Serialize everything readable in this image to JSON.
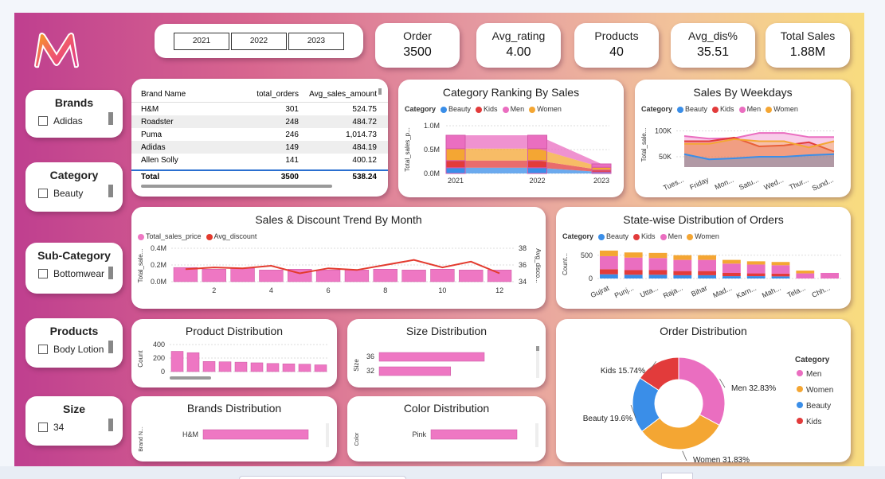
{
  "years": [
    "2021",
    "2022",
    "2023"
  ],
  "kpis": [
    {
      "label": "Order",
      "value": "3500"
    },
    {
      "label": "Avg_rating",
      "value": "4.00"
    },
    {
      "label": "Products",
      "value": "40"
    },
    {
      "label": "Avg_dis%",
      "value": "35.51"
    },
    {
      "label": "Total Sales",
      "value": "1.88M"
    }
  ],
  "slicers": [
    {
      "title": "Brands",
      "item": "Adidas"
    },
    {
      "title": "Category",
      "item": "Beauty"
    },
    {
      "title": "Sub-Category",
      "item": "Bottomwear"
    },
    {
      "title": "Products",
      "item": "Body Lotion"
    },
    {
      "title": "Size",
      "item": "34"
    }
  ],
  "brand_table": {
    "headers": [
      "Brand Name",
      "total_orders",
      "Avg_sales_amount"
    ],
    "rows": [
      [
        "H&M",
        "301",
        "524.75"
      ],
      [
        "Roadster",
        "248",
        "484.72"
      ],
      [
        "Puma",
        "246",
        "1,014.73"
      ],
      [
        "Adidas",
        "149",
        "484.19"
      ],
      [
        "Allen Solly",
        "141",
        "400.12"
      ]
    ],
    "total": [
      "Total",
      "3500",
      "538.24"
    ]
  },
  "colors": {
    "beauty": "#3a8ee8",
    "kids": "#e23b3b",
    "men": "#ea6ec0",
    "women": "#f4a633",
    "bar_pink": "#ee77c3",
    "line_red": "#e33b2e"
  },
  "legend": {
    "label": "Category",
    "items": [
      "Beauty",
      "Kids",
      "Men",
      "Women"
    ]
  },
  "category_ranking": {
    "title": "Category Ranking By Sales",
    "y_axis_label": "Total_sales_p...",
    "y_ticks": [
      "1.0M",
      "0.5M",
      "0.0M"
    ],
    "x_ticks": [
      "2021",
      "2022",
      "2023"
    ],
    "chart_data": {
      "type": "area",
      "x": [
        "2021",
        "2022",
        "2023"
      ],
      "series": [
        {
          "name": "Beauty",
          "values": [
            0.12,
            0.12,
            0.03
          ]
        },
        {
          "name": "Kids",
          "values": [
            0.15,
            0.15,
            0.04
          ]
        },
        {
          "name": "Women",
          "values": [
            0.25,
            0.25,
            0.06
          ]
        },
        {
          "name": "Men",
          "values": [
            0.28,
            0.28,
            0.07
          ]
        }
      ]
    }
  },
  "weekdays": {
    "title": "Sales By Weekdays",
    "y_axis_label": "Total_sale...",
    "y_ticks": [
      "100K",
      "50K"
    ],
    "x_ticks": [
      "Tues...",
      "Friday",
      "Mon...",
      "Satu...",
      "Wed...",
      "Thur...",
      "Sund..."
    ],
    "chart_data": {
      "type": "area",
      "series": [
        {
          "name": "Beauty",
          "values": [
            55,
            45,
            47,
            50,
            50,
            53,
            55
          ]
        },
        {
          "name": "Kids",
          "values": [
            80,
            80,
            87,
            70,
            72,
            78,
            60
          ]
        },
        {
          "name": "Men",
          "values": [
            90,
            85,
            86,
            96,
            96,
            88,
            88
          ]
        },
        {
          "name": "Women",
          "values": [
            75,
            75,
            84,
            80,
            80,
            68,
            80
          ]
        }
      ]
    }
  },
  "monthly": {
    "title": "Sales & Discount Trend By Month",
    "legend": [
      "Total_sales_price",
      "Avg_discount"
    ],
    "y_left_label": "Total_sale...",
    "y_right_label": "Avg_disco...",
    "y_left_ticks": [
      "0.4M",
      "0.2M",
      "0.0M"
    ],
    "y_right_ticks": [
      "38",
      "36",
      "34"
    ],
    "x_ticks": [
      "2",
      "4",
      "6",
      "8",
      "10",
      "12"
    ],
    "chart_data": {
      "type": "bar",
      "categories": [
        "1",
        "2",
        "3",
        "4",
        "5",
        "6",
        "7",
        "8",
        "9",
        "10",
        "11",
        "12"
      ],
      "series": [
        {
          "name": "Total_sales_price",
          "values": [
            0.17,
            0.15,
            0.16,
            0.14,
            0.15,
            0.14,
            0.14,
            0.15,
            0.14,
            0.15,
            0.14,
            0.14
          ]
        },
        {
          "name": "Avg_discount",
          "values": [
            35.5,
            35.7,
            35.6,
            35.9,
            35.0,
            35.6,
            35.4,
            36.0,
            36.6,
            35.7,
            36.4,
            35.0
          ]
        }
      ]
    }
  },
  "state": {
    "title": "State-wise Distribution of Orders",
    "y_axis_label": "Count...",
    "y_ticks": [
      "500",
      "0"
    ],
    "x_ticks": [
      "Gujrat",
      "Punj...",
      "Utta...",
      "Raja...",
      "Bihar",
      "Mad...",
      "Karn...",
      "Mah...",
      "Tela...",
      "Chh..."
    ],
    "chart_data": {
      "type": "bar",
      "categories": [
        "Gujrat",
        "Punj...",
        "Utta...",
        "Raja...",
        "Bihar",
        "Mad...",
        "Karn...",
        "Mah...",
        "Tela...",
        "Chh..."
      ],
      "series": [
        {
          "name": "Beauty",
          "values": [
            90,
            80,
            80,
            70,
            70,
            50,
            50,
            45,
            0,
            0
          ]
        },
        {
          "name": "Kids",
          "values": [
            110,
            100,
            100,
            90,
            90,
            70,
            60,
            60,
            0,
            0
          ]
        },
        {
          "name": "Men",
          "values": [
            280,
            270,
            260,
            240,
            240,
            200,
            190,
            180,
            110,
            120
          ]
        },
        {
          "name": "Women",
          "values": [
            120,
            110,
            110,
            100,
            100,
            80,
            70,
            70,
            60,
            0
          ]
        }
      ]
    }
  },
  "product_dist": {
    "title": "Product Distribution",
    "y_axis_label": "Count",
    "y_ticks": [
      "400",
      "200",
      "0"
    ],
    "chart_data": {
      "type": "bar",
      "values": [
        300,
        280,
        150,
        145,
        140,
        130,
        120,
        115,
        110,
        100
      ]
    }
  },
  "size_dist": {
    "title": "Size Distribution",
    "y_axis_label": "Size",
    "chart_data": {
      "type": "bar",
      "categories": [
        "36",
        "32"
      ],
      "values": [
        100,
        68
      ]
    }
  },
  "brands_dist": {
    "title": "Brands Distribution",
    "y_axis_label": "Brand N...",
    "chart_data": {
      "type": "bar",
      "categories": [
        "H&M"
      ],
      "values": [
        100
      ]
    }
  },
  "color_dist": {
    "title": "Color Distribution",
    "y_axis_label": "Color",
    "chart_data": {
      "type": "bar",
      "categories": [
        "Pink"
      ],
      "values": [
        100
      ]
    }
  },
  "order_dist": {
    "title": "Order Distribution",
    "legend_title": "Category",
    "chart_data": {
      "type": "pie",
      "slices": [
        {
          "name": "Men",
          "value": 32.83,
          "label": "Men 32.83%"
        },
        {
          "name": "Women",
          "value": 31.83,
          "label": "Women 31.83%"
        },
        {
          "name": "Beauty",
          "value": 19.6,
          "label": "Beauty 19.6%"
        },
        {
          "name": "Kids",
          "value": 15.74,
          "label": "Kids 15.74%"
        }
      ]
    }
  }
}
